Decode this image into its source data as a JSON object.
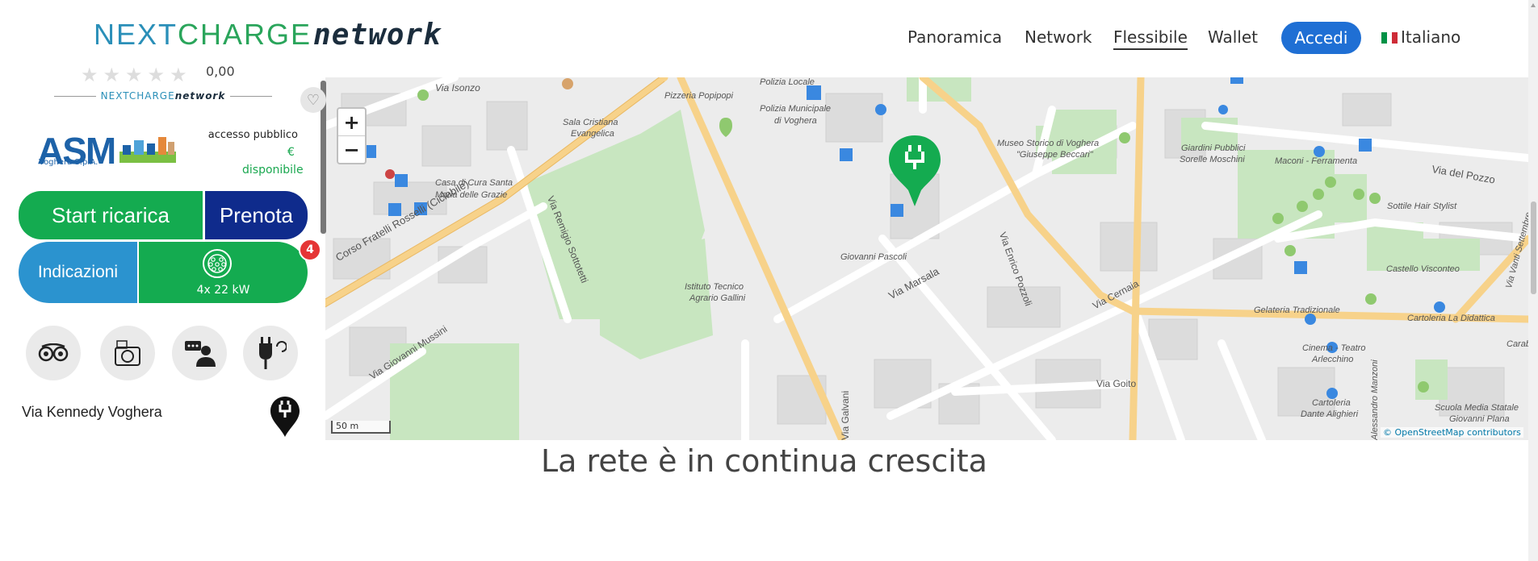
{
  "header": {
    "logo": {
      "part1": "NEXT",
      "part2": "CHARGE",
      "part3": "network"
    },
    "nav": [
      {
        "label": "Panoramica",
        "active": false
      },
      {
        "label": "Network",
        "active": false
      },
      {
        "label": "Flessibile",
        "active": true
      },
      {
        "label": "Wallet",
        "active": false
      }
    ],
    "login_label": "Accedi",
    "language": "Italiano"
  },
  "panel": {
    "rating": "0,00",
    "network_label_1": "NEXTCHARGE",
    "network_label_2": "network",
    "operator_logo": "ASM",
    "operator_sub": "Voghera S.p.A.",
    "access_label": "accesso pubblico",
    "price_symbol": "€",
    "availability": "disponibile",
    "start_button": "Start ricarica",
    "book_button": "Prenota",
    "directions_button": "Indicazioni",
    "connector_power": "4x 22 kW",
    "connector_count": "4",
    "icons": [
      "tripadvisor-icon",
      "camera-icon",
      "chat-support-icon",
      "plug-refresh-icon"
    ],
    "address": "Via Kennedy Voghera"
  },
  "map": {
    "zoom_in": "+",
    "zoom_out": "−",
    "scale": "50 m",
    "attribution_symbol": "©",
    "attribution": "OpenStreetMap contributors",
    "labels": {
      "via_isonzo": "Via Isonzo",
      "pizzeria": "Pizzeria Popipopi",
      "polizia_locale": "Polizia Locale",
      "polizia_municipale": "Polizia Municipale",
      "di_voghera": "di Voghera",
      "sala_cristiana": "Sala Cristiana",
      "evangelica": "Evangelica",
      "casa_cura": "Casa di Cura Santa",
      "maria_grazie": "Maria delle Grazie",
      "corso_rosselli": "Corso Fratelli Rosselli (Ciclabile)",
      "via_remigio": "Via Remigio Sottotetti",
      "via_giovanni_mussini": "Via Giovanni Mussini",
      "istituto": "Istituto Tecnico",
      "agrario": "Agrario Gallini",
      "giovanni_pascoli": "Giovanni Pascoli",
      "via_marsala": "Via Marsala",
      "via_enrico": "Via Enrico Pozzoli",
      "museo": "Museo Storico di Voghera",
      "giuseppe": "\"Giuseppe Beccari\"",
      "via_cernaia": "Via Cernaia",
      "via_goito": "Via Goito",
      "via_galvani": "Via Galvani",
      "giardini": "Giardini Pubblici",
      "sorelle": "Sorelle Moschini",
      "maconi": "Maconi - Ferramenta",
      "via_pozzo": "Via del Pozzo",
      "sottile": "Sottile Hair Stylist",
      "castello": "Castello Visconteo",
      "gelateria": "Gelateria Tradizionale",
      "cartoleria_didattica": "Cartoleria La Didattica",
      "via_vanti": "Via Vanti Settembre",
      "cinema": "Cinema - Teatro",
      "arlecchino": "Arlecchino",
      "alessandro": "Alessandro Manzoni",
      "cartoleria": "Cartoleria",
      "dante": "Dante Alighieri",
      "scuola": "Scuola Media Statale",
      "giovanni_plana": "Giovanni Plana",
      "carab": "Carab"
    }
  },
  "headline": "La rete è in continua crescita",
  "colors": {
    "green": "#14ab50",
    "navy": "#0f2b8c",
    "blue": "#2b93cf",
    "login_blue": "#1f6fd4",
    "badge_red": "#e53535"
  }
}
